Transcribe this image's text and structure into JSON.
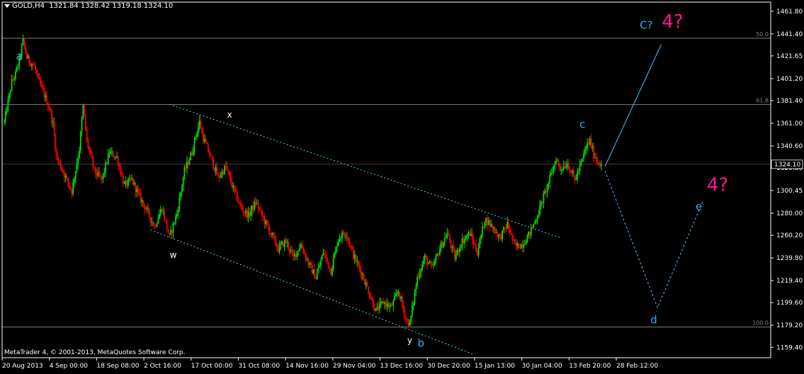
{
  "header": {
    "symbol": "GOLD,H4",
    "ohlc": "1321.84 1328.42 1319.18 1324.10"
  },
  "footer": {
    "copyright": "MetaTrader 4, © 2001-2013, MetaQuotes Software Corp."
  },
  "colors": {
    "background": "#000000",
    "axis": "#ffffff",
    "bull": "#00e000",
    "bear": "#ff0000",
    "channel": "#40e0e0",
    "projection": "#40c8ff",
    "wave_label_blue": "#2ab4f0",
    "wave_label_pink": "#ff1493",
    "fib_line": "#808080"
  },
  "chart_data": {
    "type": "candlestick",
    "symbol": "GOLD",
    "timeframe": "H4",
    "current_price": 1324.1,
    "current_price_label": "1324.10",
    "y_range": [
      1150,
      1470
    ],
    "y_ticks": [
      1461.8,
      1441.4,
      1421.65,
      1401.2,
      1381.4,
      1361.0,
      1340.6,
      1320.8,
      1300.45,
      1280.0,
      1260.2,
      1239.8,
      1219.4,
      1199.6,
      1179.2,
      1159.4
    ],
    "y_tick_labels": [
      "1461.80",
      "1441.40",
      "1421.65",
      "1401.20",
      "1381.40",
      "1361.00",
      "1340.60",
      "1320.80",
      "1300.45",
      "1280.00",
      "1260.20",
      "1239.80",
      "1219.40",
      "1199.60",
      "1179.20",
      "1159.40"
    ],
    "x_tick_labels": [
      "20 Aug 2013",
      "4 Sep 00:00",
      "18 Sep 08:00",
      "2 Oct 16:00",
      "17 Oct 00:00",
      "31 Oct 08:00",
      "14 Nov 16:00",
      "29 Nov 04:00",
      "13 Dec 16:00",
      "30 Dec 20:00",
      "15 Jan 13:00",
      "30 Jan 04:00",
      "13 Feb 20:00",
      "28 Feb 12:00"
    ],
    "fib_levels": [
      {
        "label": "50.0",
        "price": 1437.5
      },
      {
        "label": "61.8",
        "price": 1377.8
      },
      {
        "label": "100.0",
        "price": 1177.6
      }
    ],
    "price_path": [
      [
        0,
        1362
      ],
      [
        2,
        1398
      ],
      [
        3,
        1405
      ],
      [
        4,
        1418
      ],
      [
        5,
        1435
      ],
      [
        6,
        1420
      ],
      [
        8,
        1412
      ],
      [
        9,
        1400
      ],
      [
        10,
        1392
      ],
      [
        12,
        1375
      ],
      [
        13,
        1360
      ],
      [
        14,
        1330
      ],
      [
        16,
        1315
      ],
      [
        18,
        1300
      ],
      [
        20,
        1338
      ],
      [
        21,
        1376
      ],
      [
        22,
        1345
      ],
      [
        24,
        1318
      ],
      [
        26,
        1310
      ],
      [
        28,
        1335
      ],
      [
        30,
        1330
      ],
      [
        32,
        1305
      ],
      [
        34,
        1310
      ],
      [
        36,
        1295
      ],
      [
        38,
        1282
      ],
      [
        40,
        1268
      ],
      [
        42,
        1285
      ],
      [
        44,
        1258
      ],
      [
        46,
        1280
      ],
      [
        48,
        1318
      ],
      [
        50,
        1335
      ],
      [
        51,
        1350
      ],
      [
        52,
        1362
      ],
      [
        53,
        1348
      ],
      [
        55,
        1330
      ],
      [
        57,
        1312
      ],
      [
        59,
        1322
      ],
      [
        61,
        1302
      ],
      [
        63,
        1285
      ],
      [
        65,
        1278
      ],
      [
        67,
        1290
      ],
      [
        69,
        1275
      ],
      [
        71,
        1262
      ],
      [
        73,
        1248
      ],
      [
        75,
        1255
      ],
      [
        77,
        1240
      ],
      [
        79,
        1252
      ],
      [
        81,
        1235
      ],
      [
        83,
        1222
      ],
      [
        85,
        1245
      ],
      [
        87,
        1228
      ],
      [
        89,
        1258
      ],
      [
        91,
        1263
      ],
      [
        93,
        1242
      ],
      [
        95,
        1228
      ],
      [
        97,
        1210
      ],
      [
        99,
        1192
      ],
      [
        101,
        1200
      ],
      [
        103,
        1195
      ],
      [
        105,
        1210
      ],
      [
        107,
        1185
      ],
      [
        108,
        1180
      ],
      [
        110,
        1222
      ],
      [
        112,
        1240
      ],
      [
        114,
        1230
      ],
      [
        116,
        1248
      ],
      [
        118,
        1262
      ],
      [
        120,
        1240
      ],
      [
        122,
        1255
      ],
      [
        124,
        1262
      ],
      [
        126,
        1245
      ],
      [
        128,
        1275
      ],
      [
        130,
        1268
      ],
      [
        132,
        1258
      ],
      [
        134,
        1270
      ],
      [
        136,
        1250
      ],
      [
        138,
        1252
      ],
      [
        140,
        1262
      ],
      [
        142,
        1278
      ],
      [
        144,
        1298
      ],
      [
        146,
        1318
      ],
      [
        147,
        1330
      ],
      [
        148,
        1320
      ],
      [
        150,
        1325
      ],
      [
        152,
        1310
      ],
      [
        154,
        1328
      ],
      [
        155,
        1340
      ],
      [
        156,
        1345
      ],
      [
        157,
        1333
      ],
      [
        158,
        1327
      ],
      [
        159,
        1324.1
      ]
    ],
    "channel_lines": [
      {
        "from": [
          44,
          1378
        ],
        "to": [
          148,
          1258
        ]
      },
      {
        "from": [
          39,
          1265
        ],
        "to": [
          125,
          1153
        ]
      }
    ],
    "projections": [
      {
        "name": "path-to-4",
        "style": "solid",
        "points": [
          [
            160,
            1322
          ],
          [
            175,
            1432
          ]
        ]
      },
      {
        "name": "path-d-e",
        "style": "dashed",
        "points": [
          [
            160,
            1318
          ],
          [
            174,
            1195
          ],
          [
            186,
            1290
          ]
        ]
      }
    ],
    "wave_labels": [
      {
        "text": "a",
        "color": "blue",
        "at": [
          4,
          1418
        ]
      },
      {
        "text": "x",
        "color": "white",
        "at": [
          60,
          1366
        ]
      },
      {
        "text": "w",
        "color": "white",
        "at": [
          45,
          1240
        ]
      },
      {
        "text": "y",
        "color": "white",
        "at": [
          108,
          1163
        ]
      },
      {
        "text": "b",
        "color": "blue",
        "at": [
          111,
          1160
        ]
      },
      {
        "text": "c",
        "color": "blue",
        "at": [
          154,
          1357
        ]
      },
      {
        "text": "C?",
        "color": "blue",
        "at": [
          171,
          1446
        ]
      },
      {
        "text": "4?",
        "color": "pink",
        "at": [
          178,
          1447
        ]
      },
      {
        "text": "d",
        "color": "blue",
        "at": [
          173,
          1181
        ]
      },
      {
        "text": "e",
        "color": "blue",
        "at": [
          185,
          1283
        ]
      },
      {
        "text": "4?",
        "color": "pink",
        "at": [
          190,
          1300
        ]
      }
    ]
  }
}
